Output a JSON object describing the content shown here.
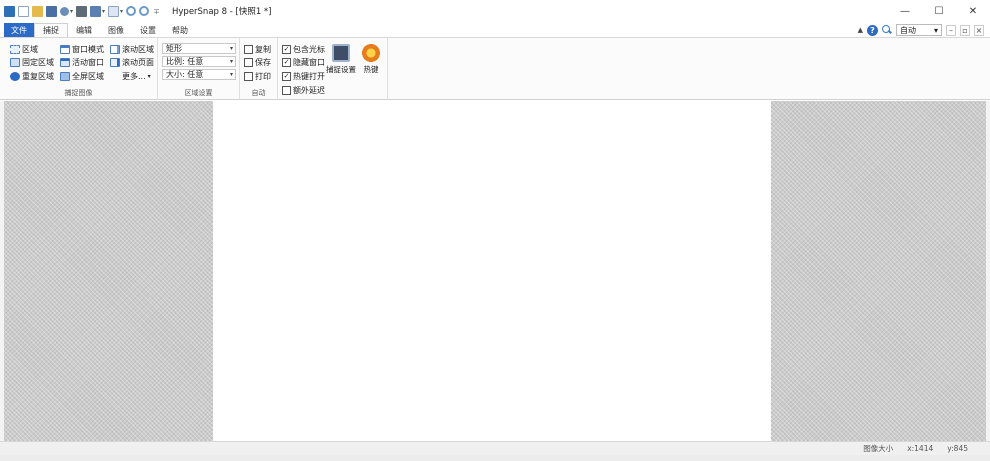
{
  "window": {
    "title": "HyperSnap 8 - [快照1 *]",
    "controls": {
      "minimize": "—",
      "maximize": "☐",
      "close": "✕"
    }
  },
  "qat": {
    "separator": "∓"
  },
  "tabs": [
    {
      "label": "文件"
    },
    {
      "label": "捕捉"
    },
    {
      "label": "编辑"
    },
    {
      "label": "图像"
    },
    {
      "label": "设置"
    },
    {
      "label": "帮助"
    }
  ],
  "help": {
    "question": "?",
    "auto_label": "自动",
    "dropdown_arrow": "▾",
    "mini_min": "–",
    "mini_restore": "▫",
    "mini_close": "×"
  },
  "ribbon": {
    "capture_group": {
      "label": "捕捉图像",
      "region": "区域",
      "fixed_region": "固定区域",
      "repeat_region": "重复区域",
      "window_mode": "窗口模式",
      "active_window": "活动窗口",
      "full_region": "全屏区域",
      "scroll_region": "滚动区域",
      "scroll_page": "滚动页面",
      "more": "更多...",
      "more_arrow": "▾"
    },
    "region_settings": {
      "label": "区域设置",
      "shape": "矩形",
      "ratio": "比例: 任意",
      "size": "大小: 任意",
      "arrow": "▾"
    },
    "auto_group": {
      "label": "自动",
      "copy": "复制",
      "save": "保存",
      "print": "打印"
    },
    "options": {
      "include_cursor": "包含光标",
      "hide_window": "隐藏窗口",
      "hotkey_open": "热键打开",
      "extra_delay": "额外延迟",
      "checkmark": "✓",
      "capture_settings": "捕捉设置",
      "hotkeys": "热键"
    }
  },
  "status": {
    "image_size": "图像大小",
    "x": "x:1414",
    "y": "y:845"
  }
}
